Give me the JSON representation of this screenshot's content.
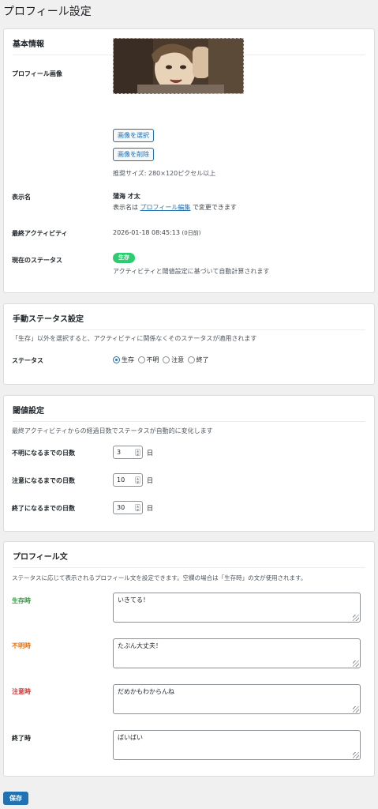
{
  "page": {
    "title": "プロフィール設定"
  },
  "basic": {
    "title": "基本情報",
    "profile_image_label": "プロフィール画像",
    "select_image_button": "画像を選択",
    "remove_image_button": "画像を削除",
    "recommended_size": "推奨サイズ: 280×120ピクセル以上",
    "display_name_label": "表示名",
    "display_name_value": "蒲海 才太",
    "display_name_help_prefix": "表示名は",
    "display_name_help_link": "プロフィール編集",
    "display_name_help_suffix": "で変更できます",
    "last_activity_label": "最終アクティビティ",
    "last_activity_value": "2026-01-18 08:45:13",
    "last_activity_ago": "(0日前)",
    "current_status_label": "現在のステータス",
    "current_status_badge": "生存",
    "current_status_badge_color": "#2ecc71",
    "current_status_help": "アクティビティと閾値設定に基づいて自動計算されます"
  },
  "manual": {
    "title": "手動ステータス設定",
    "description": "「生存」以外を選択すると、アクティビティに関係なくそのステータスが適用されます",
    "status_label": "ステータス",
    "options": [
      "生存",
      "不明",
      "注意",
      "終了"
    ],
    "selected": "生存"
  },
  "threshold": {
    "title": "閾値設定",
    "description": "最終アクティビティからの経過日数でステータスが自動的に変化します",
    "unknown_label": "不明になるまでの日数",
    "unknown_value": "3",
    "caution_label": "注意になるまでの日数",
    "caution_value": "10",
    "ended_label": "終了になるまでの日数",
    "ended_value": "30",
    "unit": "日"
  },
  "profile_text": {
    "title": "プロフィール文",
    "description": "ステータスに応じて表示されるプロフィール文を設定できます。空欄の場合は「生存時」の文が使用されます。",
    "alive_label": "生存時",
    "alive_color": "#2e9e3e",
    "alive_value": "いきてる！",
    "unknown_label": "不明時",
    "unknown_color": "#e6740e",
    "unknown_value": "たぶん大丈夫！",
    "caution_label": "注意時",
    "caution_color": "#d63638",
    "caution_value": "だめかもわからんね",
    "ended_label": "終了時",
    "ended_value": "ばいばい"
  },
  "save_button": "保存",
  "icons": {
    "resize_grip": "resize-grip-icon",
    "spinner": "spinner-arrows-icon"
  }
}
